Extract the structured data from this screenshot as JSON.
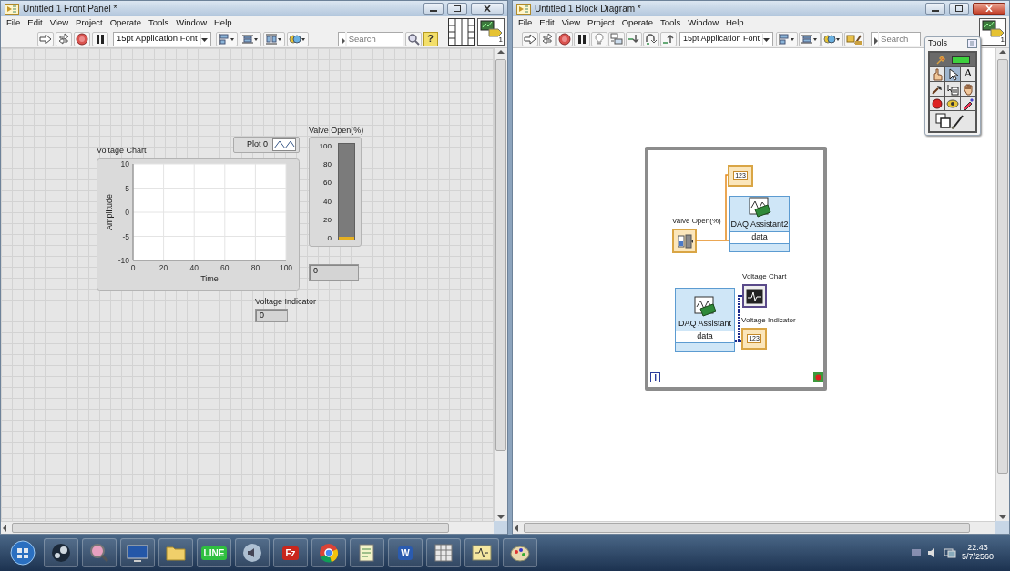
{
  "front_panel": {
    "title": "Untitled 1 Front Panel *",
    "active": false,
    "menu": [
      "File",
      "Edit",
      "View",
      "Project",
      "Operate",
      "Tools",
      "Window",
      "Help"
    ],
    "font": "15pt Application Font",
    "search_placeholder": "Search",
    "help": "?",
    "vi_number": "1",
    "chart": {
      "label": "Voltage Chart",
      "legend": "Plot 0",
      "chart_data": {
        "type": "line",
        "xlabel": "Time",
        "ylabel": "Amplitude",
        "xlim": [
          0,
          100
        ],
        "ylim": [
          -10,
          10
        ],
        "xticks": [
          0,
          20,
          40,
          60,
          80,
          100
        ],
        "yticks": [
          -10,
          -5,
          0,
          5,
          10
        ],
        "grid": true
      }
    },
    "tank": {
      "label": "Valve Open(%)",
      "scale": [
        "100",
        "80",
        "60",
        "40",
        "20",
        "0"
      ],
      "level": 0,
      "reading": "0"
    },
    "indicator": {
      "label": "Voltage Indicator",
      "value": "0"
    }
  },
  "block_diagram": {
    "title": "Untitled 1 Block Diagram *",
    "active": true,
    "menu": [
      "File",
      "Edit",
      "View",
      "Project",
      "Operate",
      "Tools",
      "Window",
      "Help"
    ],
    "font": "15pt Application Font",
    "search_placeholder": "Search",
    "vi_number": "1",
    "nodes": [
      {
        "kind": "numeric_indicator",
        "display": "123"
      },
      {
        "kind": "numeric_control",
        "label": "Valve Open(%)"
      },
      {
        "kind": "express_vi",
        "name": "DAQ Assistant2",
        "output": "data"
      },
      {
        "kind": "express_vi",
        "name": "DAQ Assistant",
        "output": "data"
      },
      {
        "kind": "chart_indicator",
        "label": "Voltage Chart"
      },
      {
        "kind": "numeric_indicator",
        "label": "Voltage Indicator",
        "display": "123"
      }
    ],
    "tools_palette": {
      "title": "Tools",
      "auto_select": true,
      "tools": [
        {
          "kind": "operate",
          "selected": false
        },
        {
          "kind": "position",
          "selected": true
        },
        {
          "kind": "text",
          "glyph": "A",
          "selected": false
        },
        {
          "kind": "wiring",
          "selected": false
        },
        {
          "kind": "shortcut",
          "selected": false
        },
        {
          "kind": "scroll",
          "selected": false
        },
        {
          "kind": "breakpoint",
          "selected": false
        },
        {
          "kind": "probe",
          "selected": false
        },
        {
          "kind": "color_copy",
          "selected": false
        },
        {
          "kind": "color",
          "selected": false
        }
      ]
    }
  },
  "taskbar": {
    "apps": [
      {
        "kind": "gamepad"
      },
      {
        "kind": "magnifier"
      },
      {
        "kind": "monitor"
      },
      {
        "kind": "folder"
      },
      {
        "kind": "chat",
        "glyph": "LINE"
      },
      {
        "kind": "audio"
      },
      {
        "kind": "ftp",
        "glyph": "Fz"
      },
      {
        "kind": "browser"
      },
      {
        "kind": "notepad"
      },
      {
        "kind": "word",
        "glyph": "W"
      },
      {
        "kind": "grid"
      },
      {
        "kind": "labview"
      },
      {
        "kind": "paint"
      }
    ],
    "time": "22:43",
    "date": "5/7/2560"
  }
}
